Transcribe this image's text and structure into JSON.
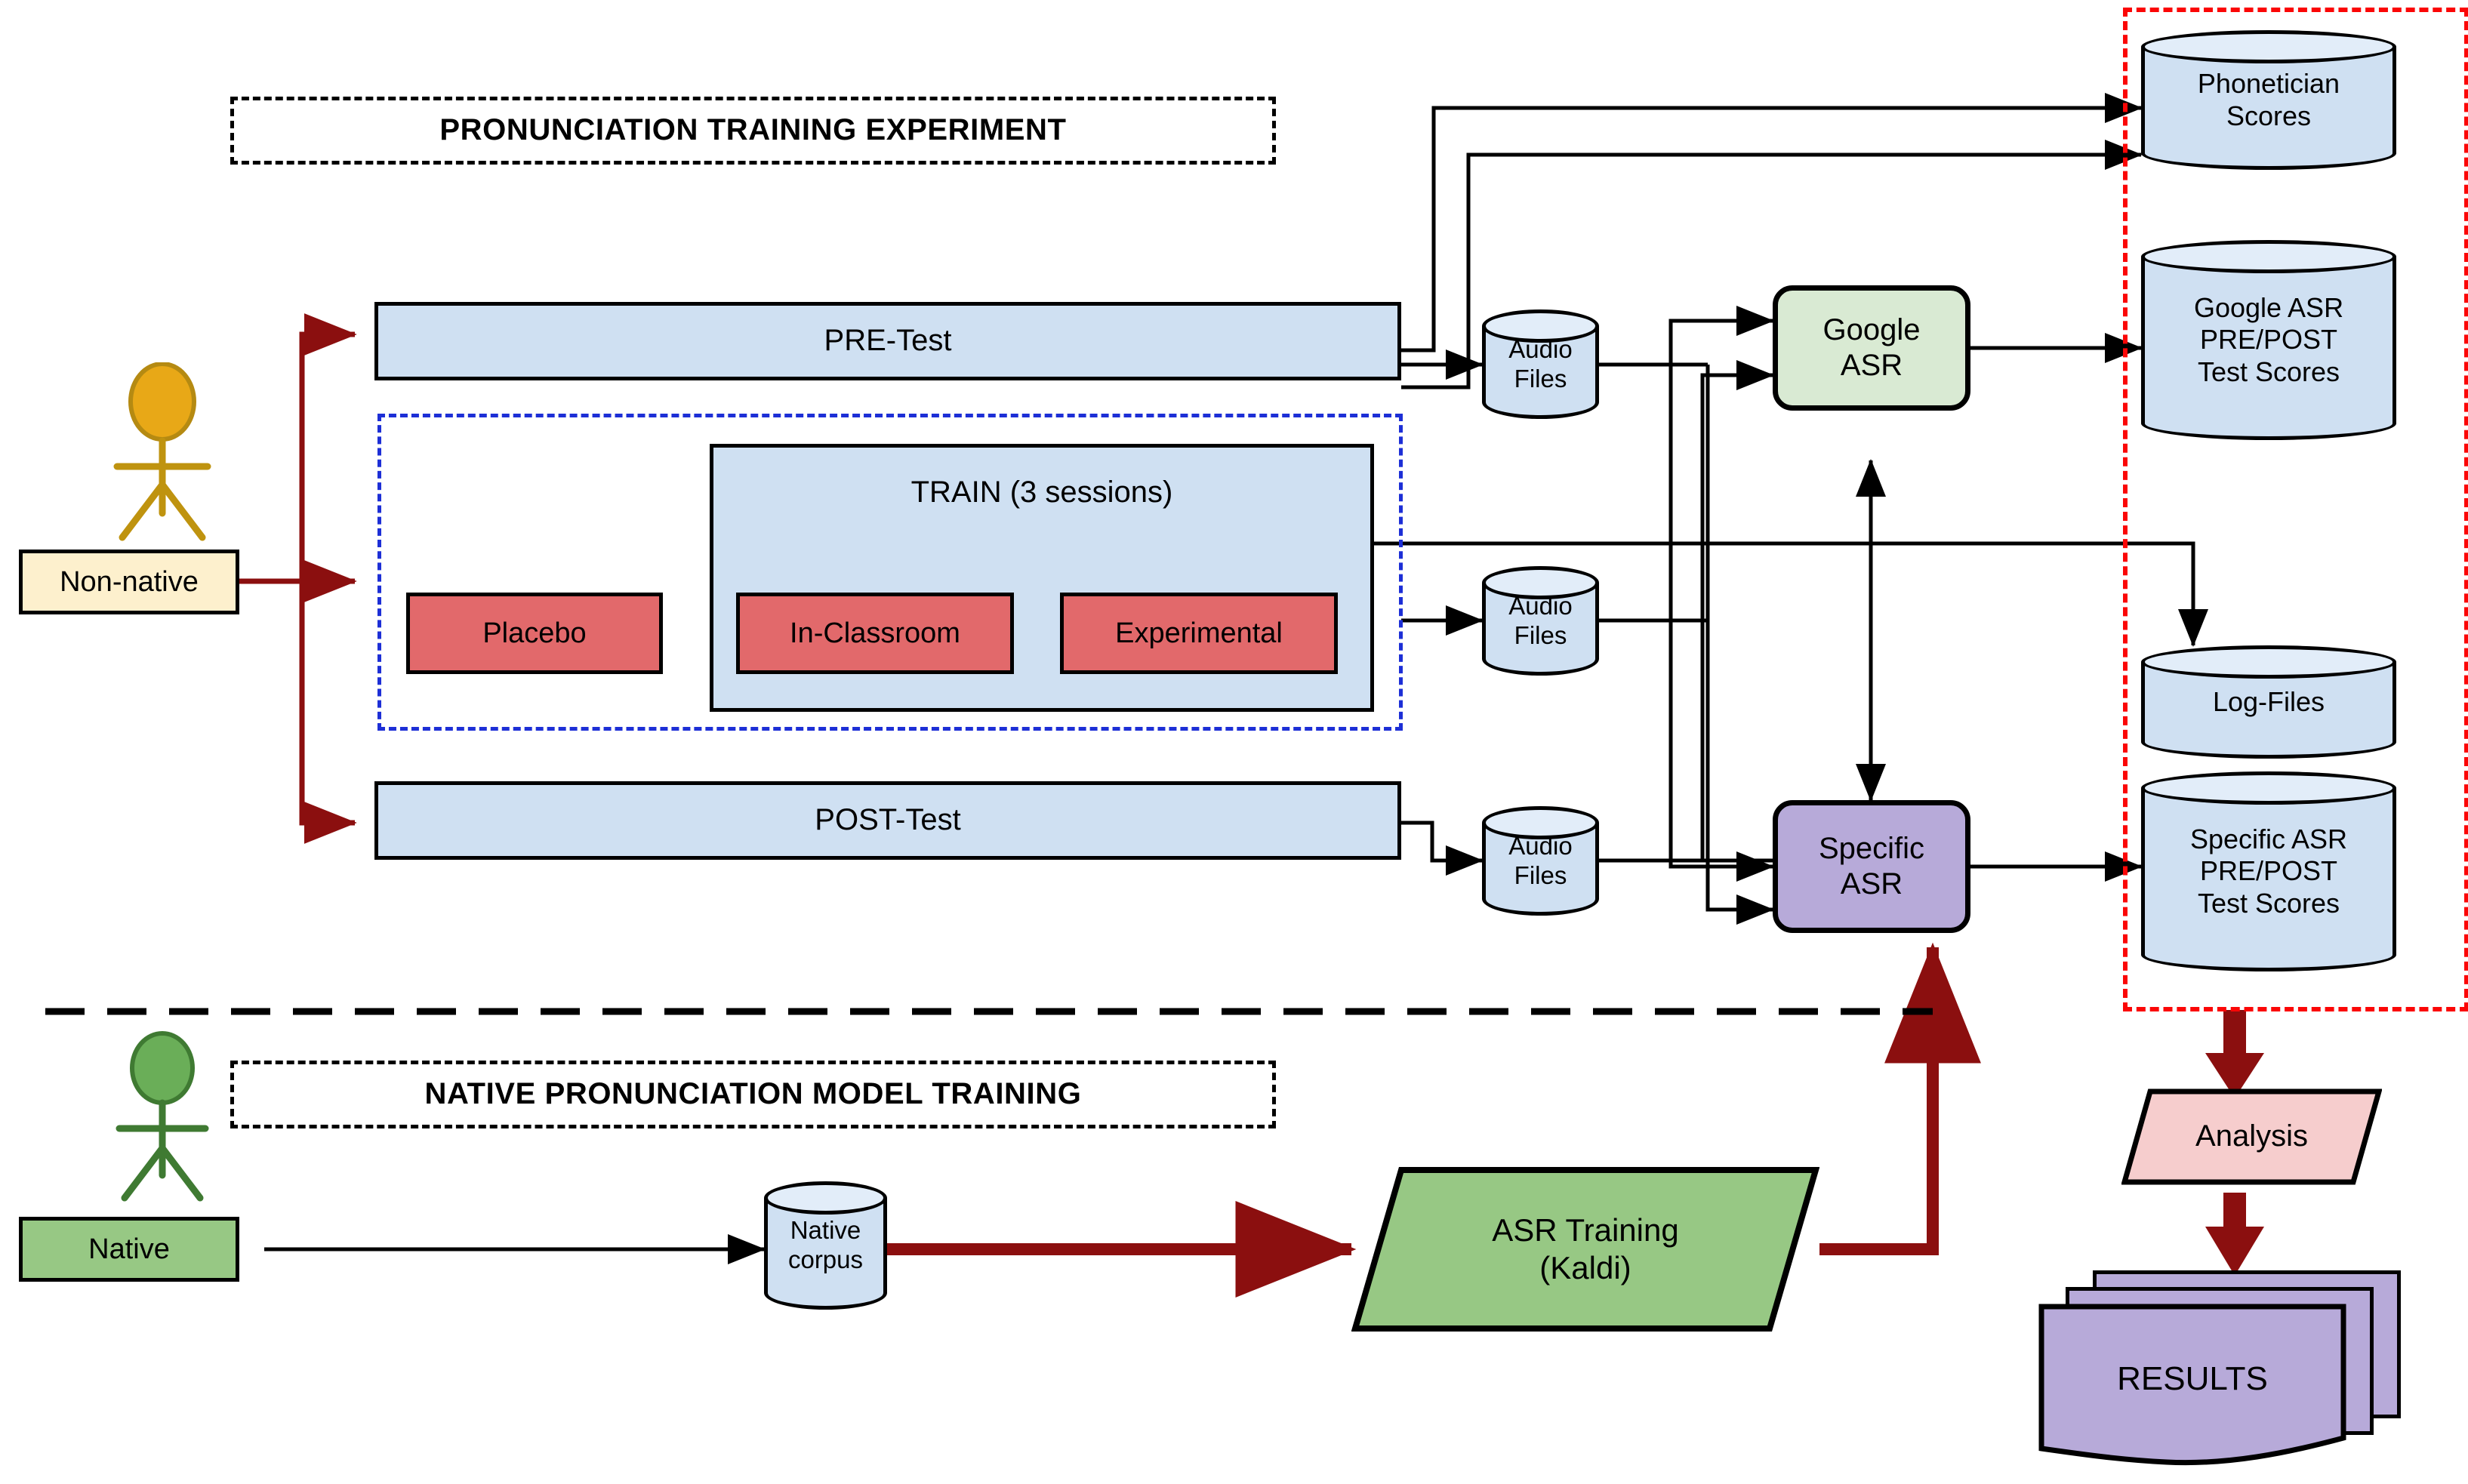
{
  "diagram": {
    "title_sections": {
      "experiment_banner": "PRONUNCIATION TRAINING EXPERIMENT",
      "native_banner": "NATIVE PRONUNCIATION MODEL TRAINING"
    },
    "actors": {
      "non_native": {
        "label": "Non-native",
        "color": "#e8a817"
      },
      "native": {
        "label": "Native",
        "color": "#4e9a3e"
      }
    },
    "experiment": {
      "pre_test": "PRE-Test",
      "post_test": "POST-Test",
      "train_group": "TRAIN (3 sessions)",
      "conditions": {
        "placebo": "Placebo",
        "in_classroom": "In-Classroom",
        "experimental": "Experimental"
      }
    },
    "stores": {
      "audio_files_pre": "Audio\nFiles",
      "audio_files_train": "Audio\nFiles",
      "audio_files_post": "Audio\nFiles",
      "native_corpus": "Native\ncorpus",
      "phonetician_scores": "Phonetician\nScores",
      "google_asr_scores": "Google ASR\nPRE/POST\nTest Scores",
      "log_files": "Log-Files",
      "specific_asr_scores": "Specific ASR\nPRE/POST\nTest Scores"
    },
    "engines": {
      "google_asr": "Google\nASR",
      "specific_asr": "Specific\nASR",
      "asr_training": "ASR Training\n(Kaldi)"
    },
    "outputs": {
      "analysis": "Analysis",
      "results": "RESULTS"
    },
    "colors": {
      "blue_fill": "#cfe0f2",
      "red_fill": "#e2696b",
      "green_fill": "#97c884",
      "light_green_fill": "#d9ead3",
      "purple_fill": "#b7aad9",
      "pink_fill": "#f6cdcd",
      "tan_fill": "#fdf0cd",
      "dark_red_arrow": "#8b0f0f",
      "blue_dashed_border": "#1d2fd6",
      "red_dashed_border": "#fb0606",
      "actor_yellow": "#e8a817",
      "actor_green": "#4e9a3e"
    }
  }
}
